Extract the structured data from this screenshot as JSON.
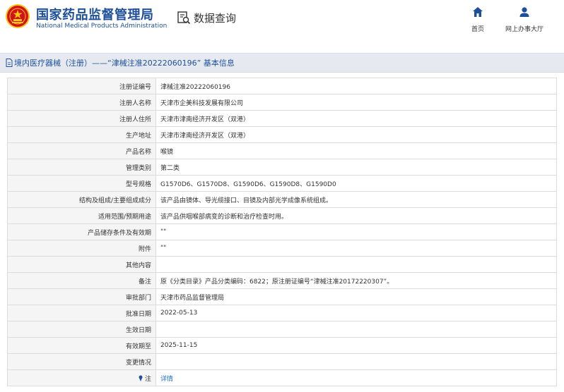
{
  "header": {
    "brand_cn": "国家药品监督管理局",
    "brand_en": "National Medical Products Administration",
    "query_label": "数据查询",
    "nav": [
      {
        "label": "首页",
        "icon": "home-icon"
      },
      {
        "label": "网上办事大厅",
        "icon": "user-icon"
      }
    ]
  },
  "title": {
    "text": "境内医疗器械（注册）——“津械注准20222060196” 基本信息"
  },
  "rows": [
    {
      "label": "注册证编号",
      "value": "津械注准20222060196"
    },
    {
      "label": "注册人名称",
      "value": "天津市企美科技发展有限公司"
    },
    {
      "label": "注册人住所",
      "value": "天津市津南经济开发区（双港）"
    },
    {
      "label": "生产地址",
      "value": "天津市津南经济开发区（双港）"
    },
    {
      "label": "产品名称",
      "value": "喉镜"
    },
    {
      "label": "管理类别",
      "value": "第二类"
    },
    {
      "label": "型号规格",
      "value": "G1570D6、G1570D8、G1590D6、G1590D8、G1590D0"
    },
    {
      "label": "结构及组成/主要组成成分",
      "value": "该产品由镜体、导光缆接口、目镜及内部光学成像系统组成。"
    },
    {
      "label": "适用范围/预期用途",
      "value": "该产品供咽喉部病变的诊断和治疗检查时用。"
    },
    {
      "label": "产品储存条件及有效期",
      "value": "\"\""
    },
    {
      "label": "附件",
      "value": "\"\""
    },
    {
      "label": "其他内容",
      "value": ""
    },
    {
      "label": "备注",
      "value": "原《分类目录》产品分类编码：6822；原注册证编号“津械注准20172220307”。"
    },
    {
      "label": "审批部门",
      "value": "天津市药品监督管理局"
    },
    {
      "label": "批准日期",
      "value": "2022-05-13"
    },
    {
      "label": "生效日期",
      "value": ""
    },
    {
      "label": "有效期至",
      "value": "2025-11-15"
    },
    {
      "label": "变更情况",
      "value": ""
    }
  ],
  "note_row": {
    "label": "注",
    "link_text": "详情"
  },
  "colors": {
    "brand_blue": "#1d4f9a",
    "emblem_red": "#d3121b",
    "emblem_gold": "#f5c518",
    "link_blue": "#1d6fc4"
  }
}
